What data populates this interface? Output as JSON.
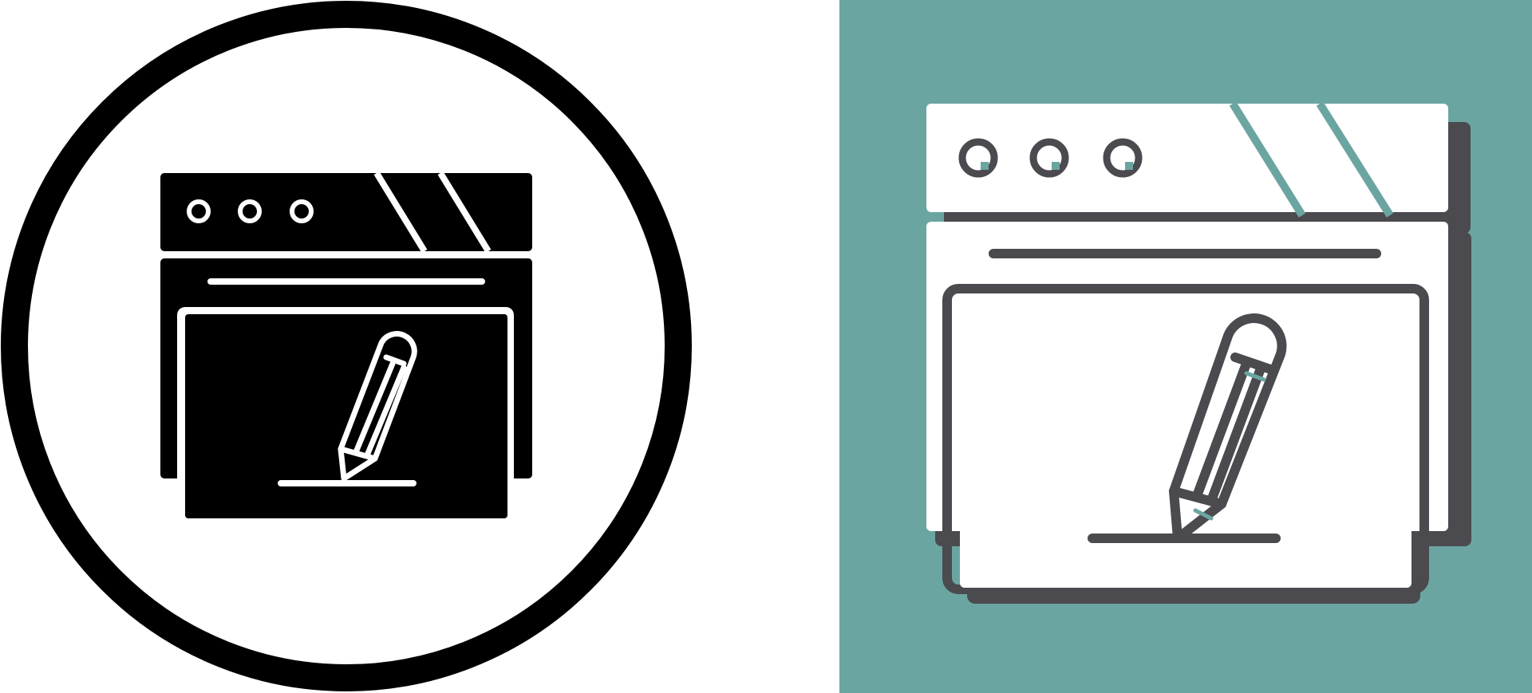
{
  "icons": [
    {
      "name": "browser-edit-icon",
      "style": "glyph",
      "background": "#ffffff",
      "foreground": "#000000",
      "stroke": "#ffffff"
    },
    {
      "name": "browser-edit-icon",
      "style": "flat-shadow",
      "background": "#6ba5a2",
      "foreground": "#ffffff",
      "shadow": "#4a4a4f",
      "outline": "#4a4a4f"
    }
  ]
}
